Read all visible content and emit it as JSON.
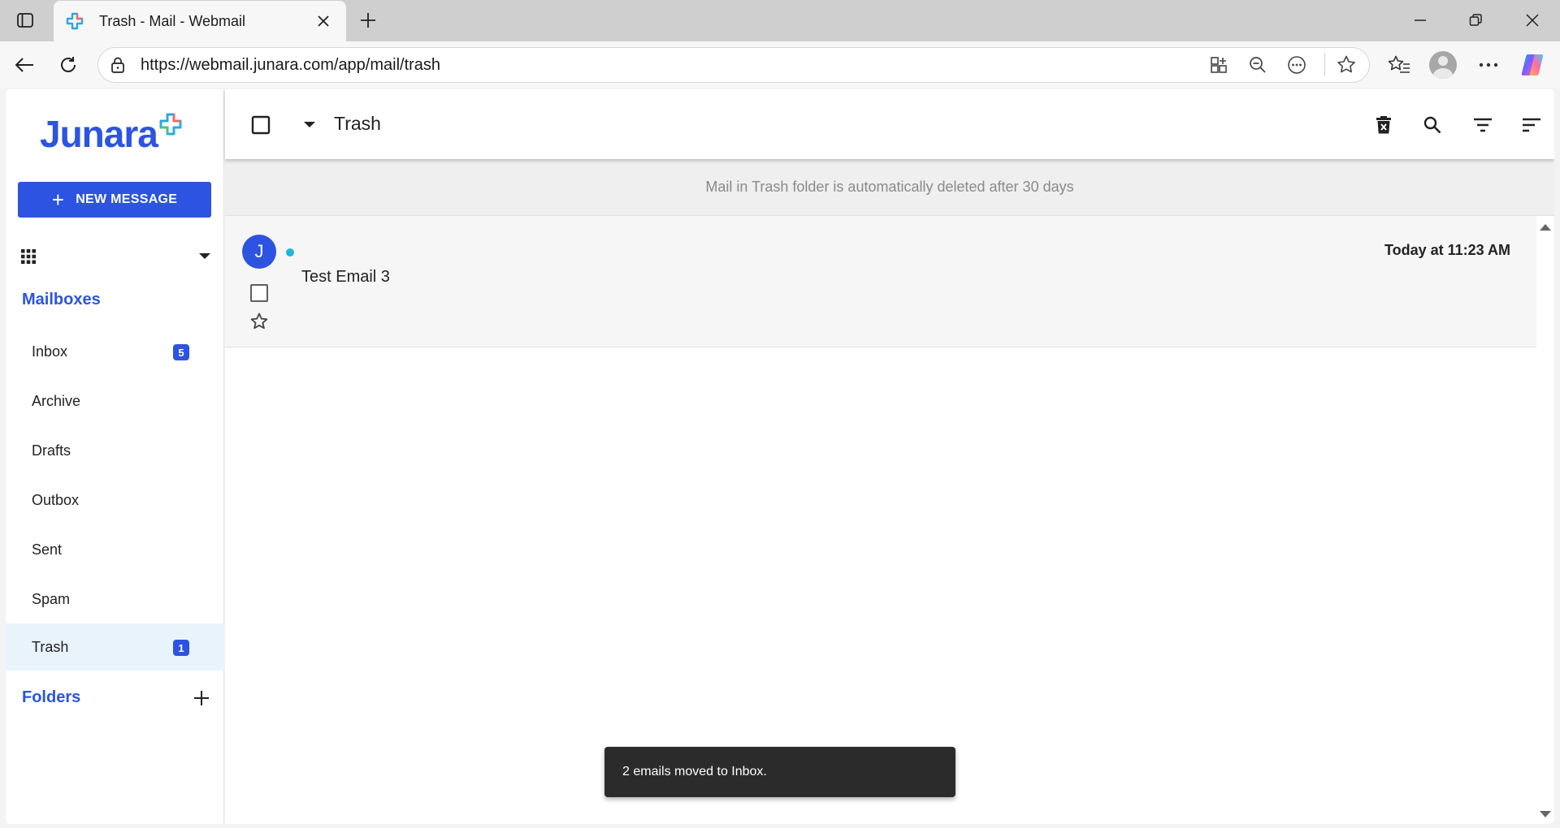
{
  "browser": {
    "tab_title": "Trash - Mail - Webmail",
    "url": "https://webmail.junara.com/app/mail/trash"
  },
  "sidebar": {
    "logo_text": "Junara",
    "new_message_label": "NEW MESSAGE",
    "mailboxes_title": "Mailboxes",
    "mailboxes": [
      {
        "label": "Inbox",
        "badge": "5"
      },
      {
        "label": "Archive"
      },
      {
        "label": "Drafts"
      },
      {
        "label": "Outbox"
      },
      {
        "label": "Sent"
      },
      {
        "label": "Spam"
      },
      {
        "label": "Trash",
        "badge": "1",
        "active": true
      }
    ],
    "folders_title": "Folders"
  },
  "main": {
    "folder_title": "Trash",
    "notice": "Mail in Trash folder is automatically deleted after 30 days",
    "emails": [
      {
        "avatar_letter": "J",
        "subject": "Test Email 3",
        "date": "Today at 11:23 AM",
        "unread": true
      }
    ]
  },
  "snackbar": {
    "message": "2 emails moved to Inbox."
  },
  "colors": {
    "accent": "#2c54e0",
    "unread_dot": "#1fb6d8",
    "active_item_bg": "#e9f3fc"
  }
}
